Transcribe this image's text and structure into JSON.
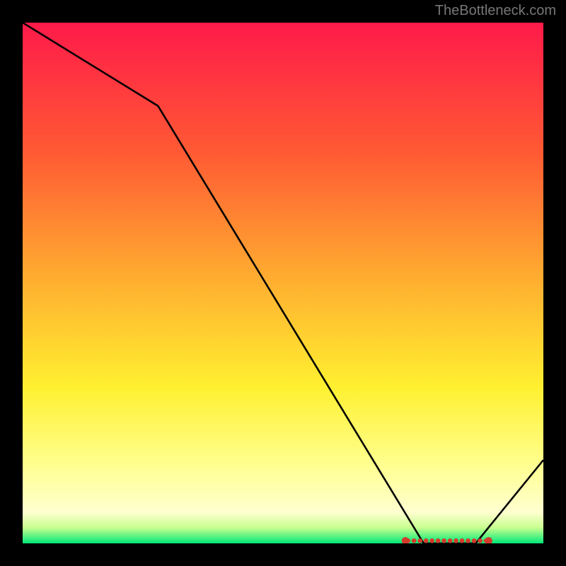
{
  "attribution": "TheBottleneck.com",
  "chart_data": {
    "type": "line",
    "title": "",
    "xlabel": "",
    "ylabel": "",
    "xlim": [
      0,
      100
    ],
    "ylim": [
      0,
      100
    ],
    "gradient_stops": [
      {
        "offset": 0,
        "color": "#ff1a4a"
      },
      {
        "offset": 25,
        "color": "#ff5a33"
      },
      {
        "offset": 50,
        "color": "#ffb030"
      },
      {
        "offset": 70,
        "color": "#fff030"
      },
      {
        "offset": 85,
        "color": "#ffff90"
      },
      {
        "offset": 94,
        "color": "#ffffd0"
      },
      {
        "offset": 97,
        "color": "#c8ff90"
      },
      {
        "offset": 100,
        "color": "#00e878"
      }
    ],
    "curve": {
      "comment": "Bottleneck curve descending from top-left to a flat minimum near x≈77..87 then rising. Values expressed as percent of plot area (0..100).",
      "x": [
        0,
        26,
        77,
        87,
        100
      ],
      "y": [
        100,
        84,
        0,
        0,
        16
      ]
    },
    "highlight_band": {
      "comment": "Flat red-dotted optimal region at the bottom",
      "x_start": 74,
      "x_end": 89,
      "y": 0.5
    }
  }
}
